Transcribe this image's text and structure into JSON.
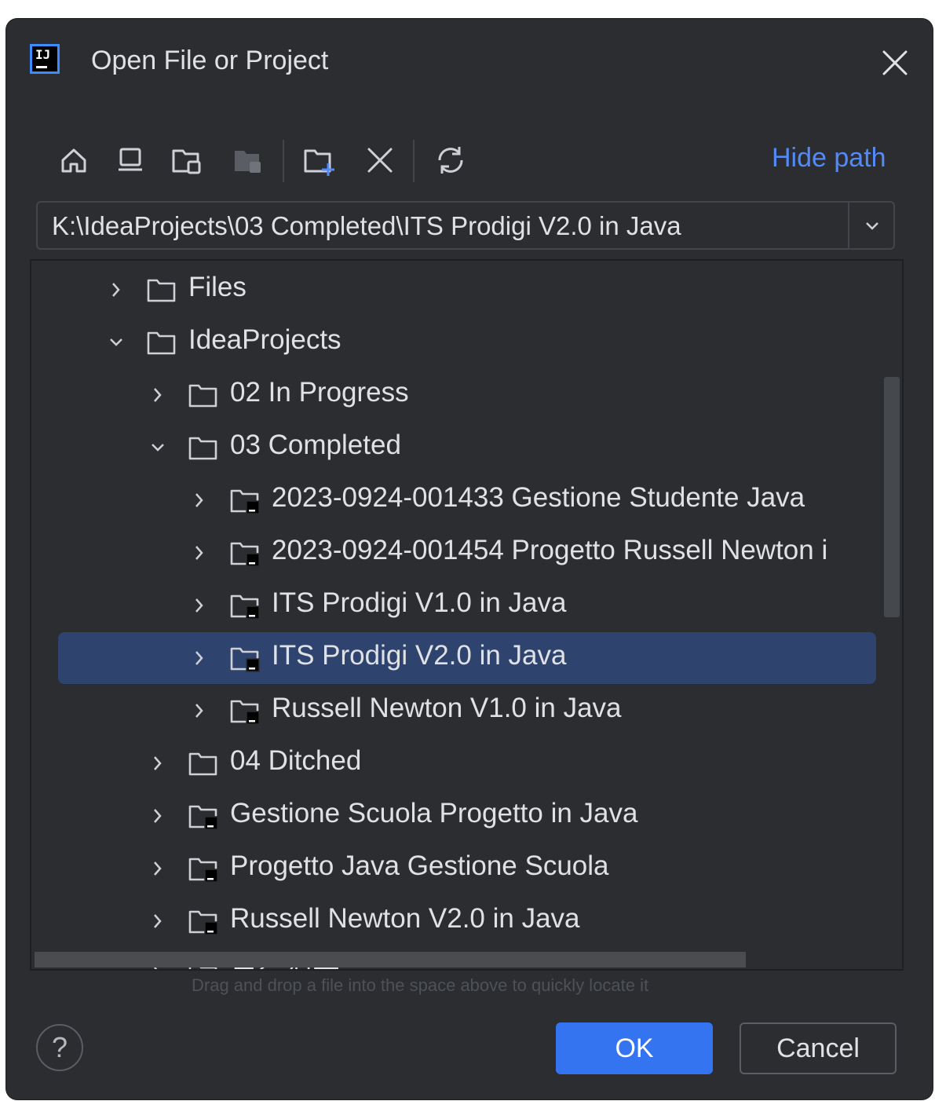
{
  "dialog": {
    "title": "Open File or Project",
    "hide_path_label": "Hide path",
    "path_value": "K:\\IdeaProjects\\03 Completed\\ITS Prodigi V2.0 in Java",
    "hint": "Drag and drop a file into the space above to quickly locate it",
    "help_label": "?",
    "ok_label": "OK",
    "cancel_label": "Cancel"
  },
  "toolbar": {
    "icons": [
      "home-icon",
      "desktop-icon",
      "project-folder-icon",
      "module-folder-icon",
      "new-folder-icon",
      "delete-icon",
      "refresh-icon"
    ]
  },
  "tree": {
    "rows": [
      {
        "label": "Files",
        "expanded": false,
        "type": "folder"
      },
      {
        "label": "IdeaProjects",
        "expanded": true,
        "type": "folder"
      },
      {
        "label": "02 In Progress",
        "expanded": false,
        "type": "folder"
      },
      {
        "label": "03 Completed",
        "expanded": true,
        "type": "folder"
      },
      {
        "label": "2023-0924-001433 Gestione Studente Java",
        "expanded": false,
        "type": "project"
      },
      {
        "label": "2023-0924-001454 Progetto Russell Newton i",
        "expanded": false,
        "type": "project"
      },
      {
        "label": "ITS Prodigi V1.0 in Java",
        "expanded": false,
        "type": "project"
      },
      {
        "label": "ITS Prodigi V2.0 in Java",
        "expanded": false,
        "type": "project",
        "selected": true
      },
      {
        "label": "Russell Newton V1.0 in Java",
        "expanded": false,
        "type": "project"
      },
      {
        "label": "04 Ditched",
        "expanded": false,
        "type": "folder"
      },
      {
        "label": "Gestione Scuola Progetto in Java",
        "expanded": false,
        "type": "project"
      },
      {
        "label": "Progetto Java Gestione Scuola",
        "expanded": false,
        "type": "project"
      },
      {
        "label": "Russell Newton V2.0 in Java",
        "expanded": false,
        "type": "project"
      },
      {
        "label": "自行保存",
        "expanded": false,
        "type": "folder"
      }
    ]
  },
  "colors": {
    "background": "#2b2d30",
    "selection": "#2e436e",
    "accent": "#3574f0",
    "link": "#548af7",
    "text": "#dfe1e5"
  }
}
